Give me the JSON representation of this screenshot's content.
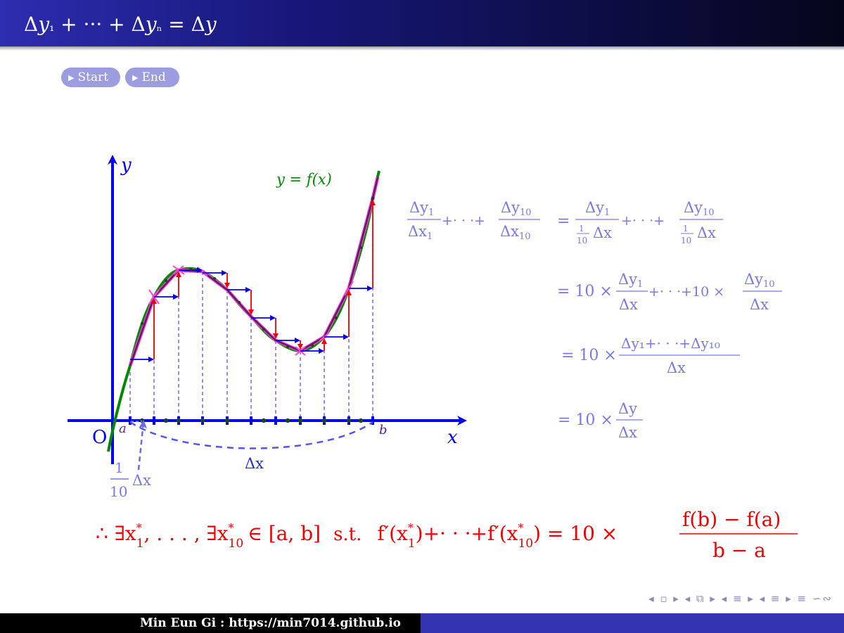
{
  "header": {
    "title_parts": [
      "Δ",
      "y",
      "₁",
      " + ··· + ",
      "Δ",
      "y",
      "ₙ",
      " = ",
      "Δ",
      "y"
    ]
  },
  "buttons": {
    "start": "Start",
    "end": "End"
  },
  "diagram": {
    "axis_x_label": "x",
    "axis_y_label": "y",
    "origin_label": "O",
    "a_label": "a",
    "b_label": "b",
    "curve_label": "y = f(x)",
    "delta_x_label": "Δx",
    "tenth_delta_num": "1",
    "tenth_delta_den": "10",
    "tenth_delta_x": "Δx",
    "colors": {
      "axis": "#0000ee",
      "curve": "#008800",
      "polyline": "#5a1a6a",
      "tangent": "#ff44cc",
      "run_arrow": "#0000ee",
      "rise_arrow": "#ee0000",
      "dashed": "#6a3ad8",
      "formula": "#7878e6",
      "conclusion": "#ee0000"
    }
  },
  "equations": {
    "line1": {
      "lhs_num1": "Δy",
      "lhs_num1_sub": "1",
      "lhs_den1": "Δx",
      "lhs_den1_sub": "1",
      "lhs_mid": "+· · ·+",
      "lhs_num2": "Δy",
      "lhs_num2_sub": "10",
      "lhs_den2": "Δx",
      "lhs_den2_sub": "10",
      "eq": "=",
      "rhs_num1": "Δy",
      "rhs_num1_sub": "1",
      "rhs_den_frac_num": "1",
      "rhs_den_frac_den": "10",
      "rhs_den": "Δx",
      "rhs_mid": "+· · ·+",
      "rhs_num2": "Δy",
      "rhs_num2_sub": "10"
    },
    "line2": {
      "prefix": "= 10 ×",
      "num1": "Δy",
      "num1_sub": "1",
      "den": "Δx",
      "mid": "+· · ·+10 ×",
      "num2": "Δy",
      "num2_sub": "10"
    },
    "line3": {
      "prefix": "= 10 ×",
      "num": "Δy₁+· · ·+Δy₁₀",
      "den": "Δx"
    },
    "line4": {
      "prefix": "= 10 ×",
      "num": "Δy",
      "den": "Δx"
    }
  },
  "conclusion": {
    "part1": "∴ ∃x",
    "sub1": "1",
    "sep": ", . . . , ∃x",
    "sub2": "10",
    "interval": "∈ [a, b]",
    "st": "s.t.",
    "fprime1": "f′(x",
    "mid": ")+· · ·+f′(x",
    "end": ") = 10 ×",
    "frac_num": "f(b) − f(a)",
    "frac_den": "b − a"
  },
  "nav_symbols": "◂ ▫ ▸ ◂ ⧉ ▸ ◂ ≡ ▸ ◂ ≡ ▸   ≡   ∽∾",
  "footer": {
    "text": "Min Eun Gi : https://min7014.github.io"
  }
}
